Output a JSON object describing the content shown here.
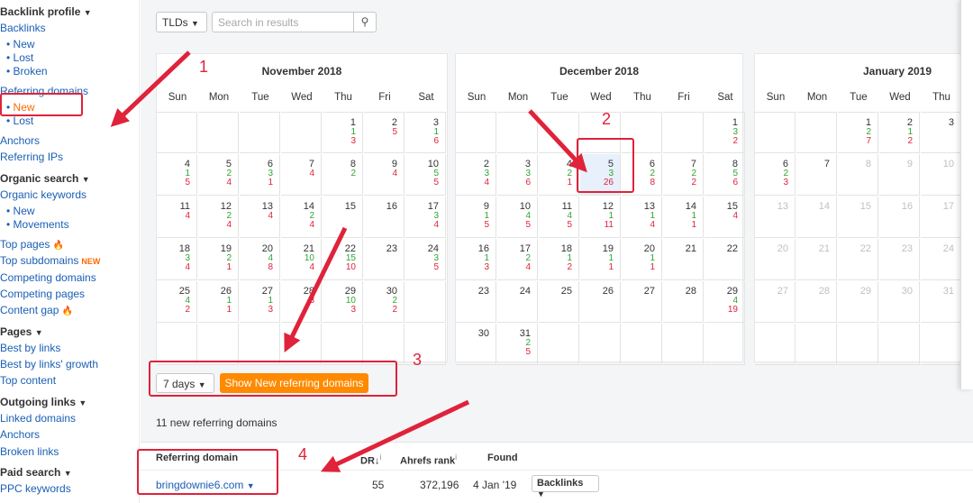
{
  "sidebar": {
    "backlink_profile": "Backlink profile",
    "backlinks": "Backlinks",
    "backlinks_new": "New",
    "backlinks_lost": "Lost",
    "backlinks_broken": "Broken",
    "referring_domains": "Referring domains",
    "rd_new": "New",
    "rd_lost": "Lost",
    "anchors": "Anchors",
    "referring_ips": "Referring IPs",
    "organic_search": "Organic search",
    "organic_keywords": "Organic keywords",
    "ok_new": "New",
    "ok_movements": "Movements",
    "top_pages": "Top pages",
    "top_subdomains": "Top subdomains",
    "new_badge": "NEW",
    "competing_domains": "Competing domains",
    "competing_pages": "Competing pages",
    "content_gap": "Content gap",
    "pages": "Pages",
    "best_by_links": "Best by links",
    "best_by_links_growth": "Best by links' growth",
    "top_content": "Top content",
    "outgoing_links": "Outgoing links",
    "linked_domains": "Linked domains",
    "out_anchors": "Anchors",
    "broken_links": "Broken links",
    "paid_search": "Paid search",
    "ppc_keywords": "PPC keywords"
  },
  "toolbar": {
    "tlds": "TLDs",
    "search_placeholder": "Search in results"
  },
  "calendars": [
    {
      "title": "November 2018",
      "dows": [
        "Sun",
        "Mon",
        "Tue",
        "Wed",
        "Thu",
        "Fri",
        "Sat"
      ],
      "weeks": [
        [
          null,
          null,
          null,
          null,
          {
            "d": "1",
            "g": "1",
            "r": "3"
          },
          {
            "d": "2",
            "r": "5"
          },
          {
            "d": "3",
            "g": "1",
            "r": "6"
          }
        ],
        [
          {
            "d": "4",
            "g": "1",
            "r": "5"
          },
          {
            "d": "5",
            "g": "2",
            "r": "4"
          },
          {
            "d": "6",
            "g": "3",
            "r": "1"
          },
          {
            "d": "7",
            "r": "4"
          },
          {
            "d": "8",
            "g": "2"
          },
          {
            "d": "9",
            "r": "4"
          },
          {
            "d": "10",
            "g": "5",
            "r": "5"
          }
        ],
        [
          {
            "d": "11",
            "r": "4"
          },
          {
            "d": "12",
            "g": "2",
            "r": "4"
          },
          {
            "d": "13",
            "r": "4"
          },
          {
            "d": "14",
            "g": "2",
            "r": "4"
          },
          {
            "d": "15"
          },
          {
            "d": "16"
          },
          {
            "d": "17",
            "g": "3",
            "r": "4"
          }
        ],
        [
          {
            "d": "18",
            "g": "3",
            "r": "4"
          },
          {
            "d": "19",
            "g": "2",
            "r": "1"
          },
          {
            "d": "20",
            "g": "4",
            "r": "8"
          },
          {
            "d": "21",
            "g": "10",
            "r": "4"
          },
          {
            "d": "22",
            "g": "15",
            "r": "10"
          },
          {
            "d": "23"
          },
          {
            "d": "24",
            "g": "3",
            "r": "5"
          }
        ],
        [
          {
            "d": "25",
            "g": "4",
            "r": "2"
          },
          {
            "d": "26",
            "g": "1",
            "r": "1"
          },
          {
            "d": "27",
            "g": "1",
            "r": "3"
          },
          {
            "d": "28",
            "r": "3"
          },
          {
            "d": "29",
            "g": "10",
            "r": "3"
          },
          {
            "d": "30",
            "g": "2",
            "r": "2"
          },
          null
        ],
        [
          null,
          null,
          null,
          null,
          null,
          null,
          null
        ]
      ]
    },
    {
      "title": "December 2018",
      "dows": [
        "Sun",
        "Mon",
        "Tue",
        "Wed",
        "Thu",
        "Fri",
        "Sat"
      ],
      "weeks": [
        [
          null,
          null,
          null,
          null,
          null,
          null,
          {
            "d": "1",
            "g": "3",
            "r": "2"
          }
        ],
        [
          {
            "d": "2",
            "g": "3",
            "r": "4"
          },
          {
            "d": "3",
            "g": "3",
            "r": "6"
          },
          {
            "d": "4",
            "g": "2",
            "r": "1"
          },
          {
            "d": "5",
            "g": "3",
            "r": "26",
            "hl": true
          },
          {
            "d": "6",
            "g": "2",
            "r": "8"
          },
          {
            "d": "7",
            "g": "2",
            "r": "2"
          },
          {
            "d": "8",
            "g": "5",
            "r": "6"
          }
        ],
        [
          {
            "d": "9",
            "g": "1",
            "r": "5"
          },
          {
            "d": "10",
            "g": "4",
            "r": "5"
          },
          {
            "d": "11",
            "g": "4",
            "r": "5"
          },
          {
            "d": "12",
            "g": "1",
            "r": "11"
          },
          {
            "d": "13",
            "g": "1",
            "r": "4"
          },
          {
            "d": "14",
            "g": "1",
            "r": "1"
          },
          {
            "d": "15",
            "r": "4"
          }
        ],
        [
          {
            "d": "16",
            "g": "1",
            "r": "3"
          },
          {
            "d": "17",
            "g": "2",
            "r": "4"
          },
          {
            "d": "18",
            "g": "1",
            "r": "2"
          },
          {
            "d": "19",
            "g": "1",
            "r": "1"
          },
          {
            "d": "20",
            "g": "1",
            "r": "1"
          },
          {
            "d": "21"
          },
          {
            "d": "22"
          }
        ],
        [
          {
            "d": "23"
          },
          {
            "d": "24"
          },
          {
            "d": "25"
          },
          {
            "d": "26"
          },
          {
            "d": "27"
          },
          {
            "d": "28"
          },
          {
            "d": "29",
            "g": "4",
            "r": "19"
          }
        ],
        [
          {
            "d": "30"
          },
          {
            "d": "31",
            "g": "2",
            "r": "5"
          },
          null,
          null,
          null,
          null,
          null
        ]
      ]
    },
    {
      "title": "January 2019",
      "dows": [
        "Sun",
        "Mon",
        "Tue",
        "Wed",
        "Thu",
        "Fri",
        "Sat"
      ],
      "weeks": [
        [
          null,
          null,
          {
            "d": "1",
            "g": "2",
            "r": "7"
          },
          {
            "d": "2",
            "g": "1",
            "r": "2"
          },
          {
            "d": "3"
          },
          null,
          null
        ],
        [
          {
            "d": "6",
            "g": "2",
            "r": "3"
          },
          {
            "d": "7"
          },
          {
            "d": "8",
            "grey": true
          },
          {
            "d": "9",
            "grey": true
          },
          {
            "d": "10",
            "grey": true
          },
          null,
          null
        ],
        [
          {
            "d": "13",
            "grey": true
          },
          {
            "d": "14",
            "grey": true
          },
          {
            "d": "15",
            "grey": true
          },
          {
            "d": "16",
            "grey": true
          },
          {
            "d": "17",
            "grey": true
          },
          null,
          null
        ],
        [
          {
            "d": "20",
            "grey": true
          },
          {
            "d": "21",
            "grey": true
          },
          {
            "d": "22",
            "grey": true
          },
          {
            "d": "23",
            "grey": true
          },
          {
            "d": "24",
            "grey": true
          },
          null,
          null
        ],
        [
          {
            "d": "27",
            "grey": true
          },
          {
            "d": "28",
            "grey": true
          },
          {
            "d": "29",
            "grey": true
          },
          {
            "d": "30",
            "grey": true
          },
          {
            "d": "31",
            "grey": true
          },
          null,
          null
        ],
        [
          null,
          null,
          null,
          null,
          null,
          null,
          null
        ]
      ]
    }
  ],
  "controls": {
    "range": "7 days",
    "show_button": "Show New referring domains"
  },
  "summary": {
    "count_text": "11 new referring domains"
  },
  "table": {
    "headers": {
      "domain": "Referring domain",
      "dr": "DR",
      "ahrefs_rank": "Ahrefs rank",
      "found": "Found"
    },
    "rows": [
      {
        "domain": "bringdownie6.com",
        "dr": "55",
        "ahrefs_rank": "372,196",
        "found": "4 Jan '19",
        "backlinks": "Backlinks"
      }
    ]
  },
  "annotations": {
    "n1": "1",
    "n2": "2",
    "n3": "3",
    "n4": "4"
  },
  "colors": {
    "link": "#1a5fb4",
    "accent": "#ff8a00",
    "green": "#2ea535",
    "red": "#e0223a",
    "highlight": "#e7f0fb"
  }
}
